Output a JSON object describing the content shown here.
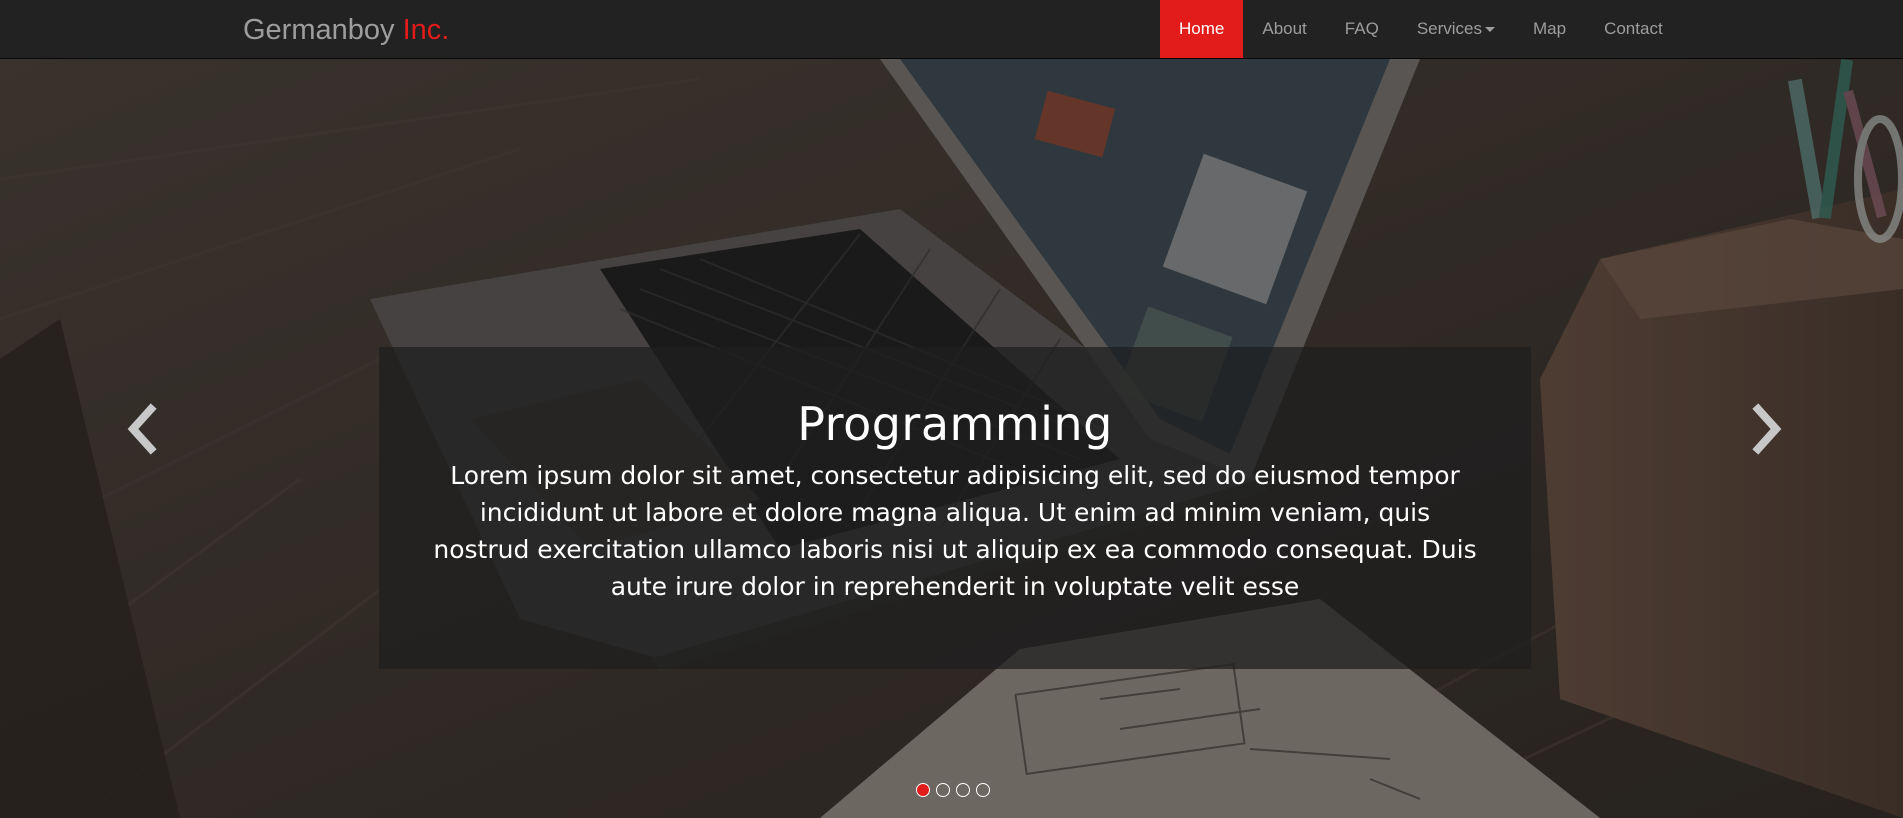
{
  "brand": {
    "name": "Germanboy",
    "suffix": "Inc."
  },
  "nav": {
    "items": [
      {
        "label": "Home"
      },
      {
        "label": "About"
      },
      {
        "label": "FAQ"
      },
      {
        "label": "Services"
      },
      {
        "label": "Map"
      },
      {
        "label": "Contact"
      }
    ],
    "active_index": 0
  },
  "carousel": {
    "caption_title": "Programming",
    "caption_text": "Lorem ipsum dolor sit amet, consectetur adipisicing elit, sed do eiusmod tempor incididunt ut labore et dolore magna aliqua. Ut enim ad minim veniam, quis nostrud exercitation ullamco laboris nisi ut aliquip ex ea commodo consequat. Duis aute irure dolor in reprehenderit in voluptate velit esse",
    "slide_count": 4,
    "active_slide": 1,
    "prev_icon": "chevron-left-icon",
    "next_icon": "chevron-right-icon"
  },
  "colors": {
    "accent": "#e21b1b",
    "navbar_bg": "#222222",
    "nav_text": "#9d9d9d",
    "caption_text": "#ffffff"
  }
}
